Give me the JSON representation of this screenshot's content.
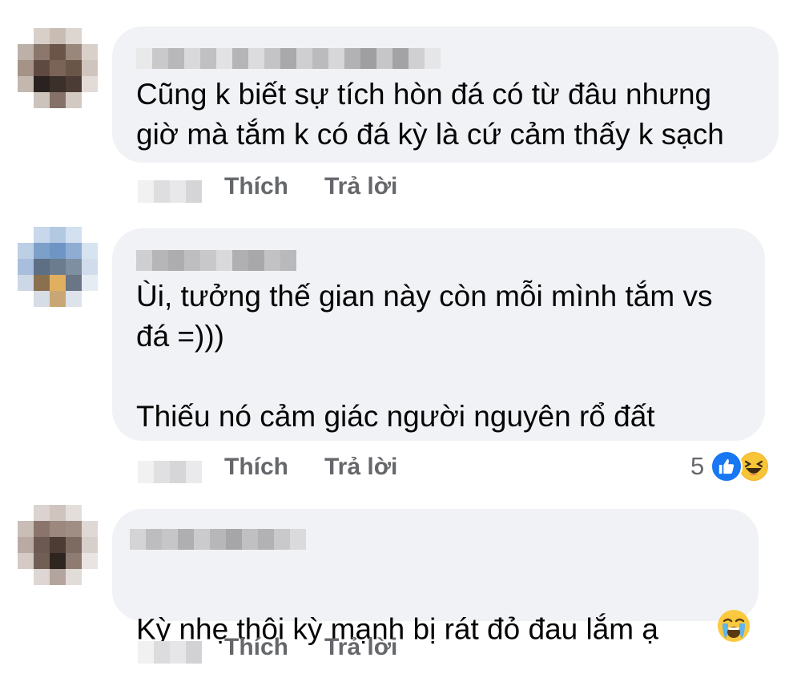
{
  "comments": [
    {
      "text": "Cũng k biết sự tích hòn đá có từ đâu nhưng\ngiờ mà tắm k có đá kỳ là cứ cảm thấy k sạch",
      "like_label": "Thích",
      "reply_label": "Trả lời"
    },
    {
      "text": "Ùi, tưởng thế gian này còn mỗi mình tắm vs\nđá =)))\n\nThiếu nó cảm giác người nguyên rổ đất",
      "like_label": "Thích",
      "reply_label": "Trả lời",
      "reaction_count": "5",
      "reactions": [
        "like-icon",
        "haha-icon"
      ]
    },
    {
      "text": "Kỳ nhẹ thôi kỳ mạnh bị rát đỏ đau lắm ạ",
      "emoji": "crying-face-emoji",
      "like_label": "Thích",
      "reply_label": "Trả lời"
    }
  ],
  "colors": {
    "bubble": "#f0f2f5",
    "text": "#050505",
    "secondary": "#65676b",
    "like_blue": "#1877f2",
    "haha_yellow": "#f7b125"
  }
}
